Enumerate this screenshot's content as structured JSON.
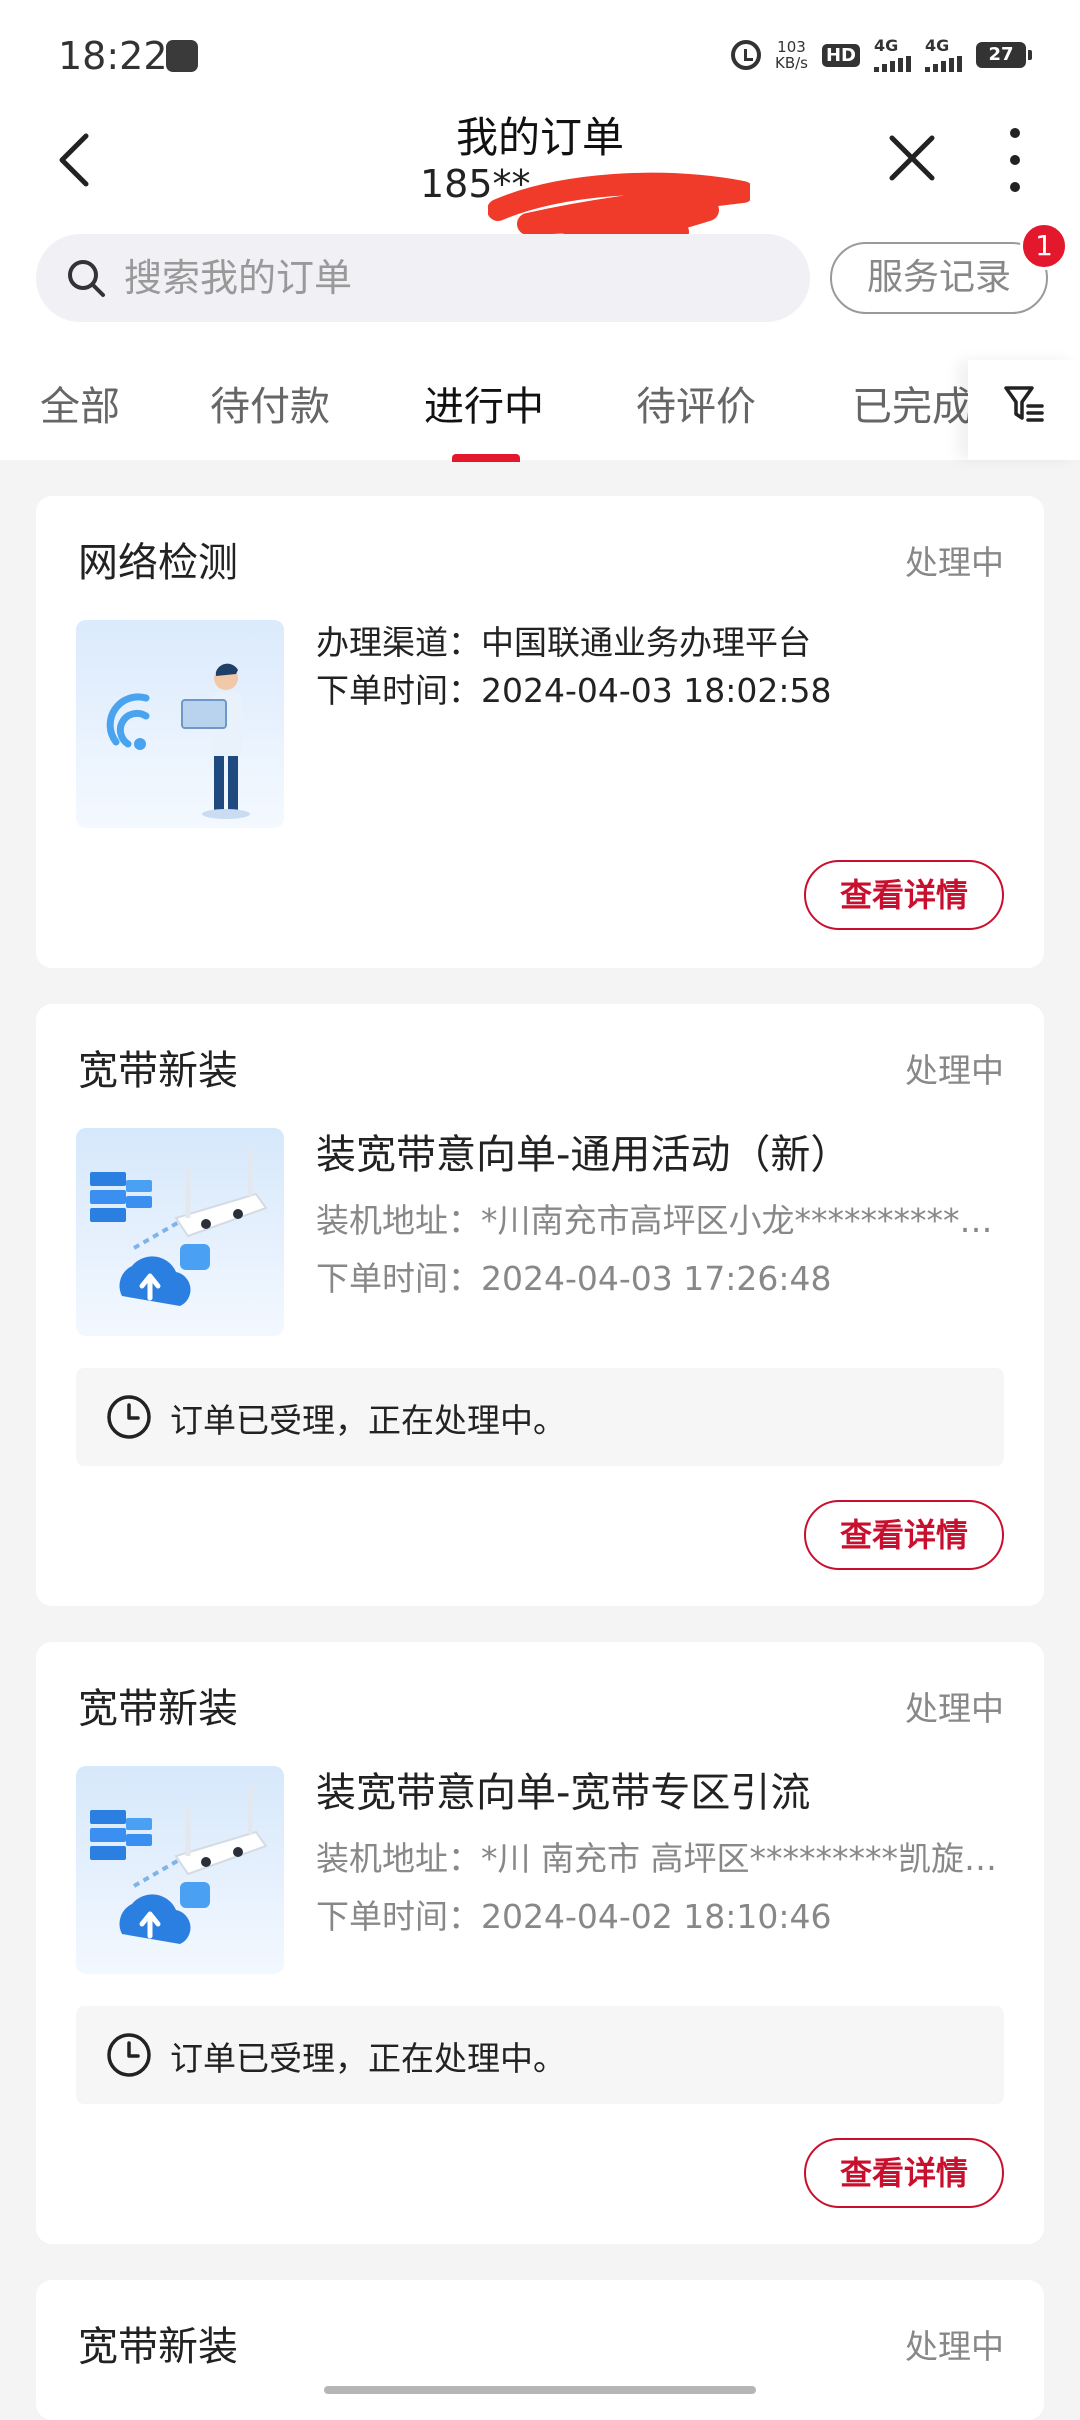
{
  "status_bar": {
    "time": "18:22",
    "net_speed_value": "103",
    "net_speed_unit": "KB/s",
    "hd_label": "HD",
    "sig1_label": "4G",
    "sig2_label": "4G",
    "battery": "27"
  },
  "nav": {
    "title": "我的订单",
    "subtitle": "185**",
    "back_icon": "chevron-left-icon",
    "close_icon": "close-icon",
    "more_icon": "more-vertical-icon"
  },
  "search": {
    "placeholder": "搜索我的订单",
    "icon": "search-icon"
  },
  "service_record": {
    "label": "服务记录",
    "badge": "1"
  },
  "tabs": [
    {
      "label": "全部",
      "active": false
    },
    {
      "label": "待付款",
      "active": false
    },
    {
      "label": "进行中",
      "active": true
    },
    {
      "label": "待评价",
      "active": false
    },
    {
      "label": "已完成",
      "active": false
    }
  ],
  "filter_icon": "filter-icon",
  "colors": {
    "accent": "#e3182d",
    "button_red": "#c8102e",
    "background": "#f4f4f4"
  },
  "orders": [
    {
      "title": "网络检测",
      "status": "处理中",
      "channel": "办理渠道：中国联通业务办理平台",
      "time": "下单时间：2024-04-03 18:02:58",
      "detail_label": "查看详情",
      "image": "network-check-illustration"
    },
    {
      "title": "宽带新装",
      "status": "处理中",
      "product": "装宽带意向单-通用活动（新）",
      "address": "装机地址：*川南充市高坪区小龙**********…",
      "time": "下单时间：2024-04-03 17:26:48",
      "notice": "订单已受理，正在处理中。",
      "detail_label": "查看详情",
      "image": "broadband-router-illustration"
    },
    {
      "title": "宽带新装",
      "status": "处理中",
      "product": "装宽带意向单-宽带专区引流",
      "address": "装机地址：*川 南充市 高坪区*********凯旋…",
      "time": "下单时间：2024-04-02 18:10:46",
      "notice": "订单已受理，正在处理中。",
      "detail_label": "查看详情",
      "image": "broadband-router-illustration"
    },
    {
      "title": "宽带新装",
      "status": "处理中"
    }
  ]
}
